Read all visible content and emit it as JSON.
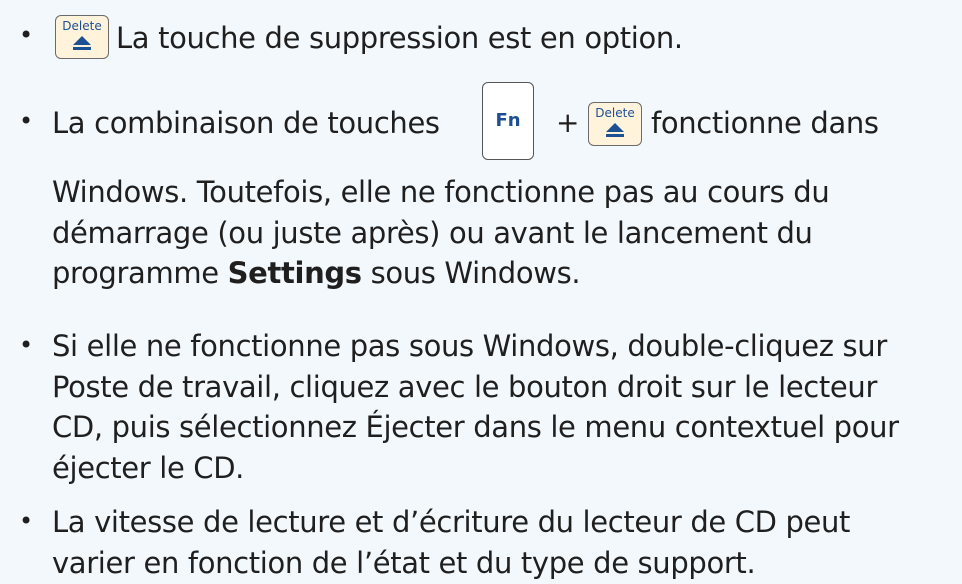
{
  "items": [
    {
      "text": "La touche de suppression est en option."
    },
    {
      "before": "La combinaison de touches",
      "plus": "+",
      "after": "fonctionne dans",
      "line2": "Windows. Toutefois, elle ne fonctionne pas au cours du",
      "line3": "démarrage (ou juste après) ou avant le lancement du",
      "line4_prefix": "programme",
      "line4_bold": "Settings",
      "line4_suffix": "sous Windows."
    },
    {
      "line1": "Si elle ne fonctionne pas sous Windows, double-cliquez sur",
      "line2": "Poste de travail, cliquez avec le bouton droit sur le lecteur",
      "line3": "CD, puis sélectionnez Éjecter dans le menu contextuel pour",
      "line4": "éjecter le CD."
    },
    {
      "line1": "La vitesse de lecture et d’écriture du lecteur de CD peut",
      "line2": "varier en fonction de l’état et du type de support."
    }
  ],
  "keys": {
    "delete_label": "Delete",
    "fn_label": "Fn"
  },
  "colors": {
    "background": "#f3f8fc",
    "key_text": "#1d4f93",
    "delete_key_fill": "#fff3dc"
  },
  "icons": [
    "eject-icon"
  ]
}
